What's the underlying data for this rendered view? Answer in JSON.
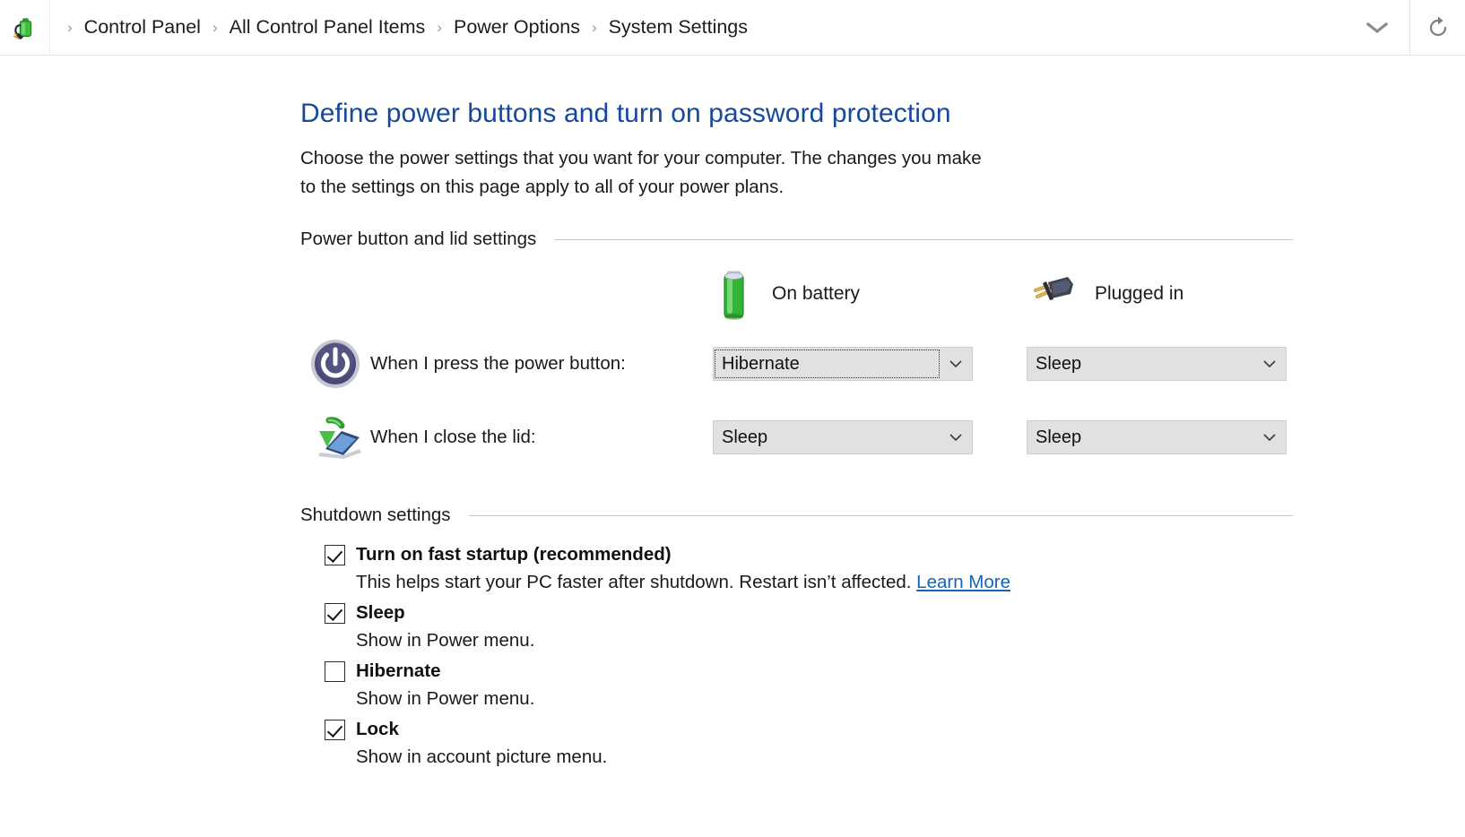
{
  "addressbar": {
    "icon_name": "power-options-battery-plug-icon",
    "crumbs": [
      {
        "label": "Control Panel"
      },
      {
        "label": "All Control Panel Items"
      },
      {
        "label": "Power Options"
      },
      {
        "label": "System Settings"
      }
    ],
    "separator": "›",
    "dropdown_icon": "chevron-down-icon",
    "refresh_icon": "refresh-icon"
  },
  "page": {
    "title": "Define power buttons and turn on password protection",
    "description": "Choose the power settings that you want for your computer. The changes you make to the settings on this page apply to all of your power plans."
  },
  "power_lid_section": {
    "heading": "Power button and lid settings",
    "columns": [
      {
        "label": "On battery",
        "icon": "battery-icon"
      },
      {
        "label": "Plugged in",
        "icon": "power-plug-icon"
      }
    ],
    "rows": [
      {
        "icon": "power-button-icon",
        "label": "When I press the power button:",
        "on_battery": "Hibernate",
        "plugged_in": "Sleep",
        "on_battery_focused": true
      },
      {
        "icon": "laptop-lid-close-icon",
        "label": "When I close the lid:",
        "on_battery": "Sleep",
        "plugged_in": "Sleep",
        "on_battery_focused": false
      }
    ]
  },
  "shutdown_section": {
    "heading": "Shutdown settings",
    "items": [
      {
        "label": "Turn on fast startup (recommended)",
        "checked": true,
        "sub": "This helps start your PC faster after shutdown. Restart isn’t affected.",
        "link": "Learn More"
      },
      {
        "label": "Sleep",
        "checked": true,
        "sub": "Show in Power menu.",
        "link": ""
      },
      {
        "label": "Hibernate",
        "checked": false,
        "sub": "Show in Power menu.",
        "link": ""
      },
      {
        "label": "Lock",
        "checked": true,
        "sub": "Show in account picture menu.",
        "link": ""
      }
    ]
  },
  "colors": {
    "title_blue": "#16489c",
    "link_blue": "#1763b5",
    "combo_bg": "#e1e1e1",
    "rule": "#c8c8c8",
    "battery_green": "#3fbf3f",
    "power_icon_purple": "#4b4a77"
  }
}
